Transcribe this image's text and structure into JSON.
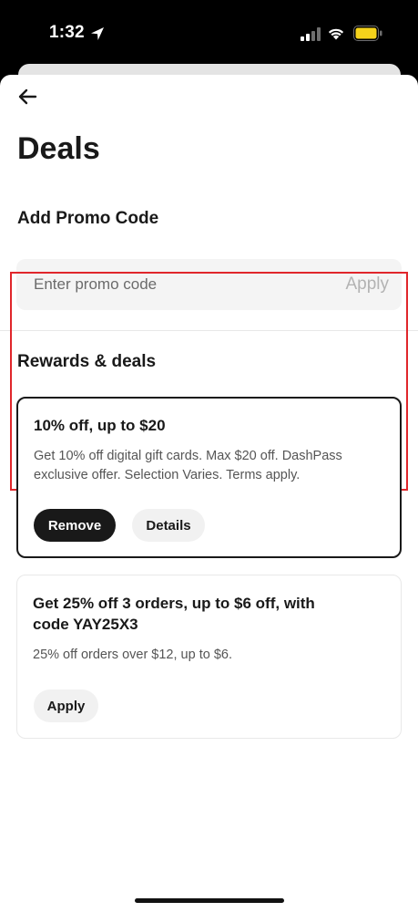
{
  "status_bar": {
    "time": "1:32"
  },
  "header": {
    "title": "Deals"
  },
  "promo": {
    "heading": "Add Promo Code",
    "placeholder": "Enter promo code",
    "value": "",
    "apply_label": "Apply"
  },
  "rewards": {
    "heading": "Rewards & deals",
    "deals": [
      {
        "title": "10% off, up to $20",
        "description_lines": [
          "Get 10% off digital gift cards. Max $20 off. DashPass",
          "exclusive offer. Selection Varies. Terms apply."
        ],
        "primary_label": "Remove",
        "secondary_label": "Details",
        "selected": true
      },
      {
        "title_lines": [
          "Get 25% off 3 orders, up to $6 off, with",
          "code YAY25X3"
        ],
        "description": "25% off orders over $12, up to $6.",
        "primary_label": "Apply",
        "selected": false
      }
    ]
  },
  "colors": {
    "highlight_border": "#e0262b",
    "text_primary": "#191919",
    "button_dark": "#191919",
    "button_light": "#f1f1f1"
  }
}
